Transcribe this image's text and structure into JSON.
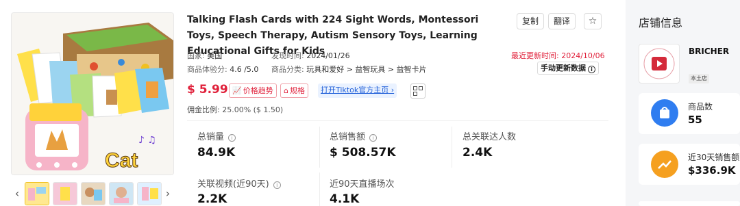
{
  "product": {
    "title": "Talking Flash Cards with 224 Sight Words, Montessori Toys, Speech Therapy, Autism Sensory Toys, Learning Educational Gifts for Kids",
    "actions": {
      "copy": "复制",
      "translate": "翻译"
    },
    "meta": {
      "country_key": "国家:",
      "country_val": "美国",
      "found_key": "发现时间:",
      "found_val": "2024/01/26",
      "updated_key": "最近更新时间:",
      "updated_val": "2024/10/06",
      "rating_key": "商品体验分:",
      "rating_val": "4.6 /5.0",
      "category_key": "商品分类:",
      "category_val": "玩具和爱好 > 益智玩具 > 益智卡片",
      "manual_update": "手动更新数据"
    },
    "price": "$ 5.99",
    "price_trend": "价格趋势",
    "spec": "规格",
    "open_tiktok": "打开Tiktok官方主页",
    "commission": "佣金比例: 25.00% ($ 1.50)",
    "thumbnail_count": 5
  },
  "stats": [
    {
      "label": "总销量",
      "value": "84.9K",
      "info": true
    },
    {
      "label": "总销售额",
      "value": "$ 508.57K",
      "info": true
    },
    {
      "label": "总关联达人数",
      "value": "2.4K",
      "info": false
    },
    {
      "label": "关联视频(近90天)",
      "value": "2.2K",
      "info": true
    },
    {
      "label": "近90天直播场次",
      "value": "4.1K",
      "info": false
    }
  ],
  "shop": {
    "panel_title": "店铺信息",
    "name": "BRICHER",
    "badge": "本土店",
    "kpis": [
      {
        "label": "商品数",
        "value": "55",
        "color": "#2f7df0"
      },
      {
        "label": "近30天销售额",
        "value": "$336.9K",
        "color": "#f5a020"
      }
    ]
  },
  "colors": {
    "accent_red": "#e0203a",
    "link_blue": "#1f5fd8"
  }
}
